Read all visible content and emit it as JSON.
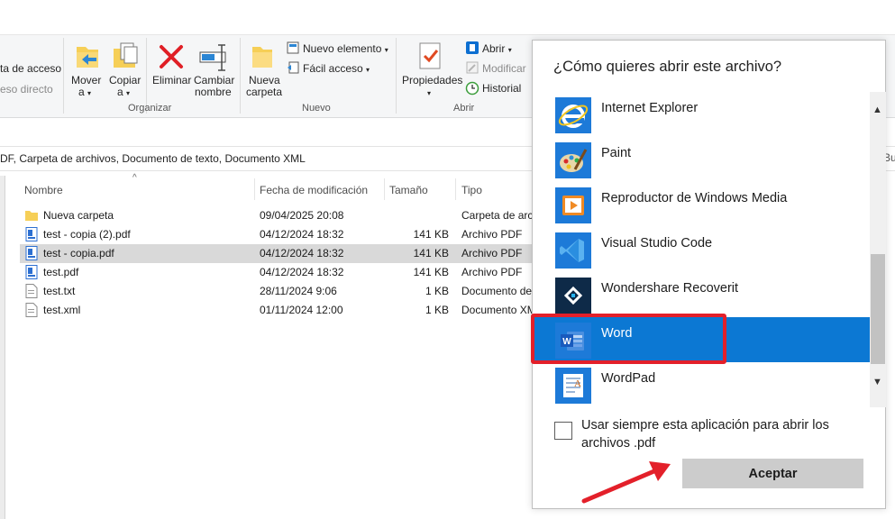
{
  "ribbon": {
    "left_items": [
      "ta de acceso",
      "eso directo"
    ],
    "move_label": "Mover",
    "move_sub": "a",
    "copy_label": "Copiar",
    "copy_sub": "a",
    "delete_label": "Eliminar",
    "rename_label_1": "Cambiar",
    "rename_label_2": "nombre",
    "group_organize": "Organizar",
    "newfolder_1": "Nueva",
    "newfolder_2": "carpeta",
    "new_item": "Nuevo elemento",
    "easy_access": "Fácil acceso",
    "group_new": "Nuevo",
    "properties": "Propiedades",
    "open": "Abrir",
    "edit": "Modificar",
    "history": "Historial",
    "group_open": "Abrir"
  },
  "pathbar": {
    "text": "DF, Carpeta de archivos, Documento de texto, Documento XML",
    "right_text": "Bu"
  },
  "columns": {
    "name": "Nombre",
    "date": "Fecha de modificación",
    "size": "Tamaño",
    "type": "Tipo"
  },
  "files": [
    {
      "name": "Nueva carpeta",
      "date": "09/04/2025 20:08",
      "size": "",
      "type": "Carpeta de archivos",
      "kind": "folder-icon"
    },
    {
      "name": "test - copia (2).pdf",
      "date": "04/12/2024 18:32",
      "size": "141 KB",
      "type": "Archivo PDF",
      "kind": "pdf-icon"
    },
    {
      "name": "test - copia.pdf",
      "date": "04/12/2024 18:32",
      "size": "141 KB",
      "type": "Archivo PDF",
      "kind": "pdf-icon"
    },
    {
      "name": "test.pdf",
      "date": "04/12/2024 18:32",
      "size": "141 KB",
      "type": "Archivo PDF",
      "kind": "pdf-icon"
    },
    {
      "name": "test.txt",
      "date": "28/11/2024 9:06",
      "size": "1 KB",
      "type": "Documento de texto",
      "kind": "txt-icon"
    },
    {
      "name": "test.xml",
      "date": "01/11/2024 12:00",
      "size": "1 KB",
      "type": "Documento XML",
      "kind": "xml-icon"
    }
  ],
  "dialog": {
    "title": "¿Cómo quieres abrir este archivo?",
    "apps": [
      {
        "name": "Internet Explorer",
        "icon": "internet-explorer-icon"
      },
      {
        "name": "Paint",
        "icon": "paint-icon"
      },
      {
        "name": "Reproductor de Windows Media",
        "icon": "media-player-icon"
      },
      {
        "name": "Visual Studio Code",
        "icon": "vscode-icon"
      },
      {
        "name": "Wondershare Recoverit",
        "icon": "recoverit-icon"
      },
      {
        "name": "Word",
        "icon": "word-icon"
      },
      {
        "name": "WordPad",
        "icon": "wordpad-icon"
      }
    ],
    "selected_app": "Word",
    "always_use_label": "Usar siempre esta aplicación para abrir los archivos .pdf",
    "ok_label": "Aceptar"
  },
  "colors": {
    "selection": "#0c78d3",
    "annotation": "#e3202a"
  }
}
